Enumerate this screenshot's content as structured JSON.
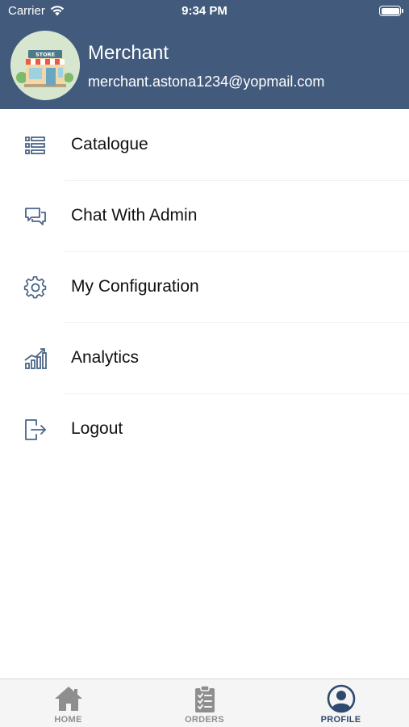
{
  "status_bar": {
    "carrier": "Carrier",
    "time": "9:34 PM"
  },
  "profile": {
    "name": "Merchant",
    "email": "merchant.astona1234@yopmail.com",
    "store_sign": "STORE"
  },
  "menu": {
    "items": [
      {
        "label": "Catalogue",
        "icon": "list-icon"
      },
      {
        "label": "Chat With Admin",
        "icon": "chat-icon"
      },
      {
        "label": "My Configuration",
        "icon": "gear-icon"
      },
      {
        "label": "Analytics",
        "icon": "bar-chart-icon"
      },
      {
        "label": "Logout",
        "icon": "logout-icon"
      }
    ]
  },
  "tab_bar": {
    "tabs": [
      {
        "label": "HOME",
        "icon": "home-icon",
        "active": false
      },
      {
        "label": "ORDERS",
        "icon": "clipboard-icon",
        "active": false
      },
      {
        "label": "PROFILE",
        "icon": "user-circle-icon",
        "active": true
      }
    ]
  },
  "colors": {
    "header_bg": "#425b7d",
    "icon_blue": "#4a6587",
    "active_tab": "#2f4a6e",
    "inactive_tab": "#8e8e8e"
  }
}
